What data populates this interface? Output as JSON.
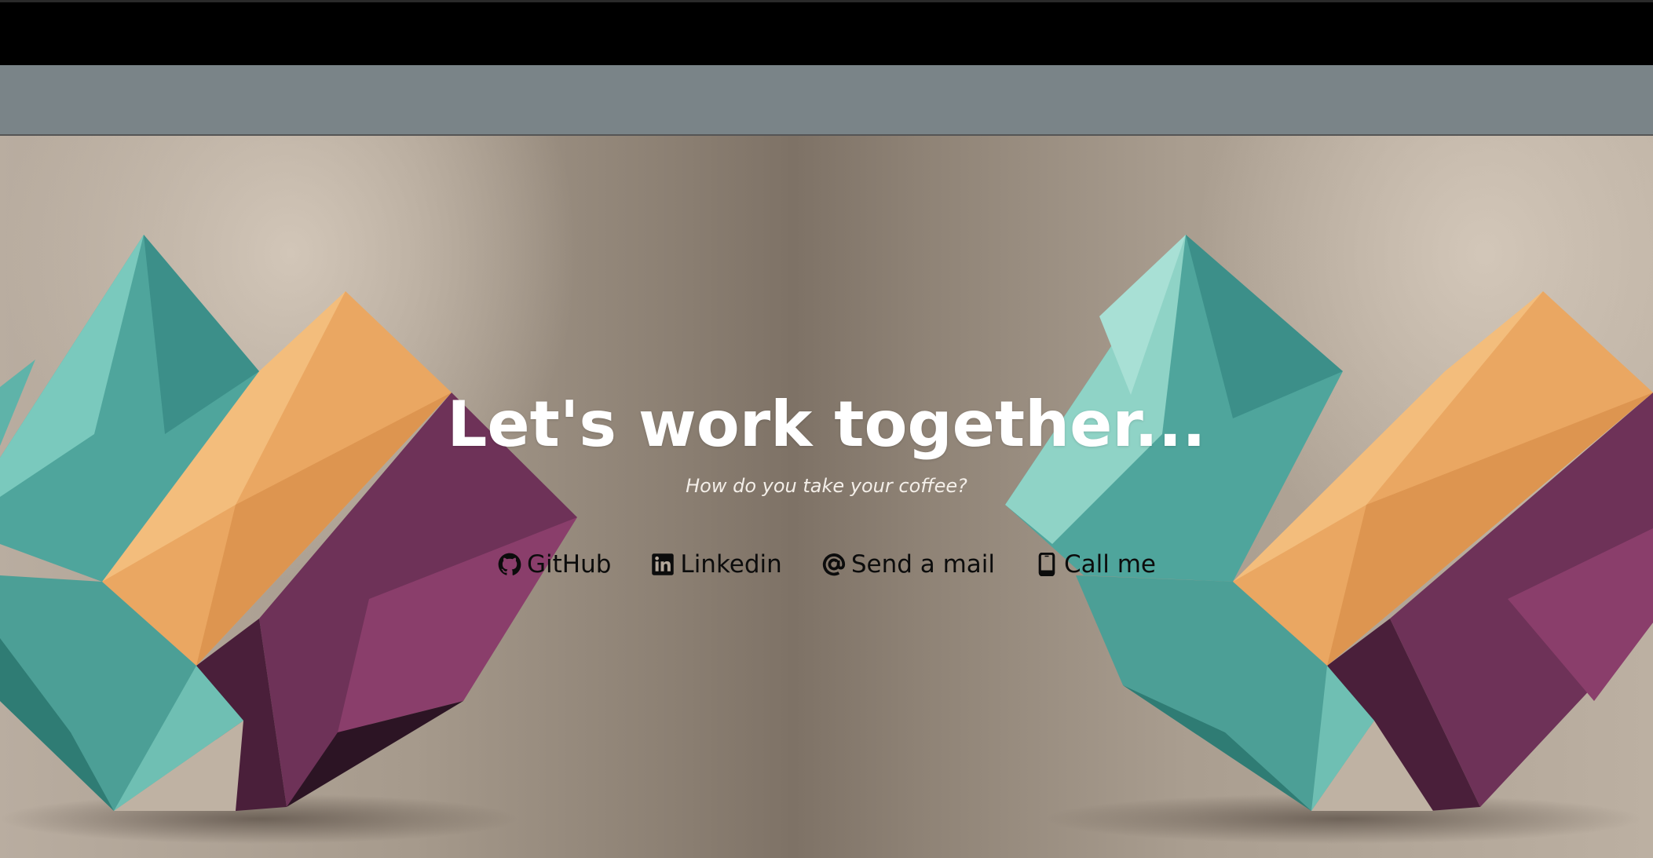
{
  "hero": {
    "headline": "Let's work together...",
    "subline": "How do you take your coffee?"
  },
  "links": [
    {
      "label": "GitHub",
      "icon": "github-icon"
    },
    {
      "label": "Linkedin",
      "icon": "linkedin-icon"
    },
    {
      "label": "Send a mail",
      "icon": "at-sign-icon"
    },
    {
      "label": "Call me",
      "icon": "phone-icon"
    }
  ],
  "colors": {
    "top_bar": "#000000",
    "grey_bar": "#7a8488",
    "teal": "#5fb3a9",
    "orange": "#eaa762",
    "purple": "#6b2f55",
    "headline": "#ffffff",
    "link_text": "#0c0c0c"
  }
}
